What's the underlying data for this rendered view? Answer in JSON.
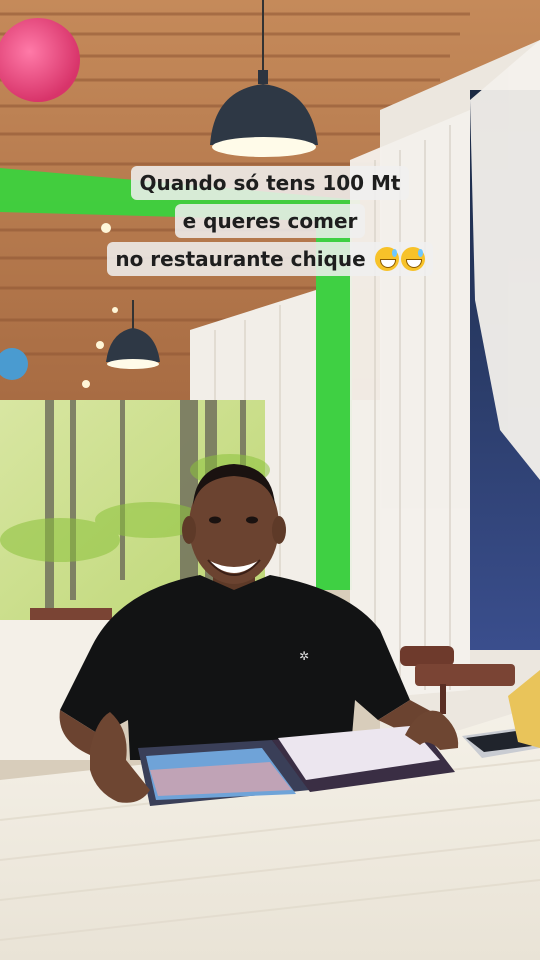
{
  "caption": {
    "line1": "Quando só tens 100 Mt",
    "line2": "e queres comer",
    "line3": "no restaurante chique",
    "emoji": "grinning-face-with-sweat-emoji"
  },
  "colors": {
    "ceiling_wood": "#b77a4c",
    "neon_green": "#3bd23d",
    "curtain": "#eeeae4",
    "shirt": "#121314",
    "tablecloth": "#f3efe6",
    "skin": "#6b4330"
  }
}
